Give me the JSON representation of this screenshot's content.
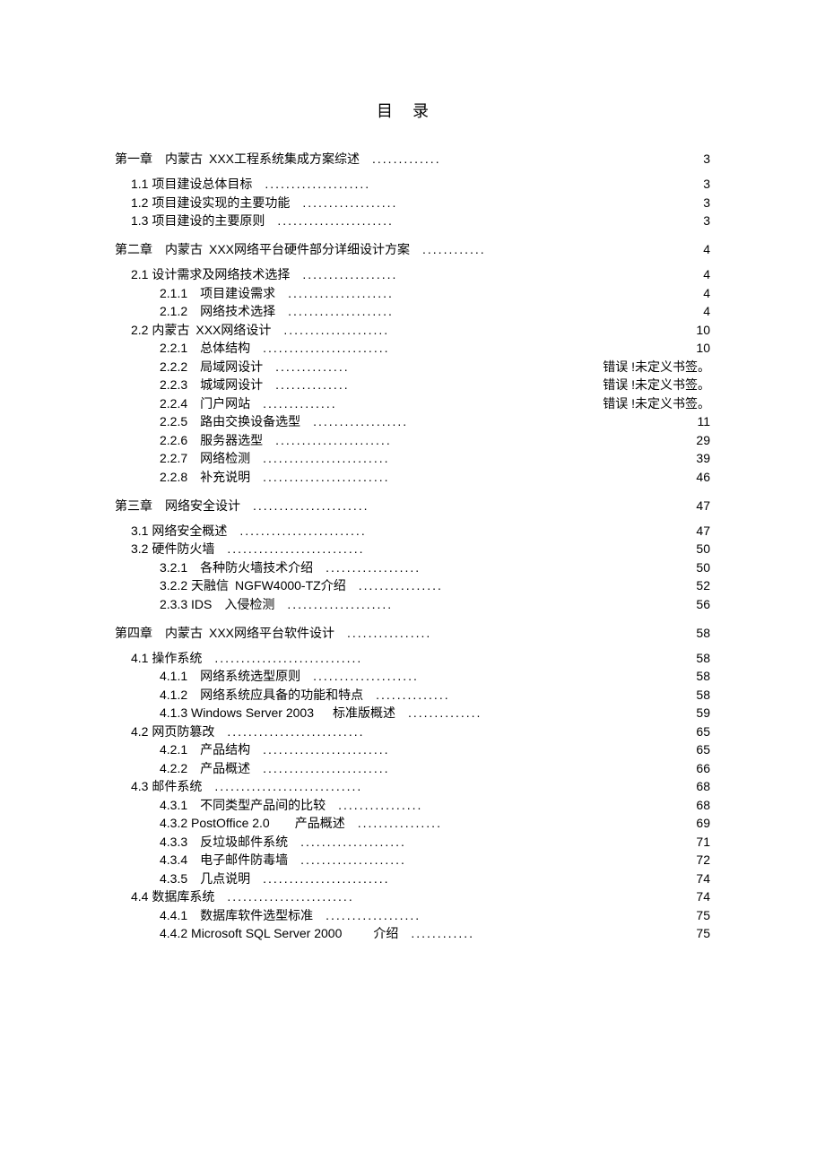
{
  "title": "目录",
  "errorText": "错误 !未定义书签。",
  "entries": [
    {
      "level": 0,
      "label": "第一章 内蒙古 XXX工程系统集成方案综述",
      "page": "3",
      "dots": 13
    },
    {
      "level": 1,
      "label": "1.1  项目建设总体目标",
      "page": "3",
      "dots": 20
    },
    {
      "level": 1,
      "label": "1.2  项目建设实现的主要功能",
      "page": "3",
      "dots": 18
    },
    {
      "level": 1,
      "label": "1.3  项目建设的主要原则",
      "page": "3",
      "dots": 22
    },
    {
      "level": 0,
      "label": "第二章 内蒙古 XXX网络平台硬件部分详细设计方案",
      "page": "4",
      "dots": 12
    },
    {
      "level": 1,
      "label": "2.1  设计需求及网络技术选择",
      "page": "4",
      "dots": 18
    },
    {
      "level": 2,
      "label": "2.1.1 项目建设需求",
      "page": "4",
      "dots": 20
    },
    {
      "level": 2,
      "label": "2.1.2 网络技术选择",
      "page": "4",
      "dots": 20
    },
    {
      "level": 1,
      "label": "2.2  内蒙古 XXX网络设计",
      "page": "10",
      "dots": 20
    },
    {
      "level": 2,
      "label": "2.2.1 总体结构",
      "page": "10",
      "dots": 24
    },
    {
      "level": 2,
      "label": "2.2.2 局域网设计",
      "page": "error",
      "dots": 14
    },
    {
      "level": 2,
      "label": "2.2.3 城域网设计",
      "page": "error",
      "dots": 14
    },
    {
      "level": 2,
      "label": "2.2.4 门户网站",
      "page": "error",
      "dots": 14
    },
    {
      "level": 2,
      "label": "2.2.5 路由交换设备选型",
      "page": "11",
      "dots": 18
    },
    {
      "level": 2,
      "label": "2.2.6 服务器选型",
      "page": "29",
      "dots": 22
    },
    {
      "level": 2,
      "label": "2.2.7 网络检测",
      "page": "39",
      "dots": 24
    },
    {
      "level": 2,
      "label": "2.2.8 补充说明",
      "page": "46",
      "dots": 24
    },
    {
      "level": 0,
      "label": "第三章 网络安全设计",
      "page": "47",
      "dots": 22
    },
    {
      "level": 1,
      "label": "3.1  网络安全概述",
      "page": "47",
      "dots": 24
    },
    {
      "level": 1,
      "label": "3.2  硬件防火墙",
      "page": "50",
      "dots": 26
    },
    {
      "level": 2,
      "label": "3.2.1 各种防火墙技术介绍",
      "page": "50",
      "dots": 18
    },
    {
      "level": 2,
      "label": "3.2.2  天融信 NGFW4000-TZ介绍",
      "page": "52",
      "dots": 16
    },
    {
      "level": 2,
      "label": "2.3.3 IDS 入侵检测",
      "page": "56",
      "dots": 20
    },
    {
      "level": 0,
      "label": "第四章 内蒙古 XXX网络平台软件设计",
      "page": "58",
      "dots": 16
    },
    {
      "level": 1,
      "label": "4.1  操作系统",
      "page": "58",
      "dots": 28
    },
    {
      "level": 2,
      "label": "4.1.1 网络系统选型原则",
      "page": "58",
      "dots": 20
    },
    {
      "level": 2,
      "label": "4.1.2 网络系统应具备的功能和特点",
      "page": "58",
      "dots": 14
    },
    {
      "level": 2,
      "label": "4.1.3 Windows Server 2003  标准版概述",
      "page": "59",
      "dots": 14
    },
    {
      "level": 1,
      "label": "4.2  网页防篡改",
      "page": "65",
      "dots": 26
    },
    {
      "level": 2,
      "label": "4.2.1 产品结构",
      "page": "65",
      "dots": 24
    },
    {
      "level": 2,
      "label": "4.2.2 产品概述",
      "page": "66",
      "dots": 24
    },
    {
      "level": 1,
      "label": "4.3  邮件系统",
      "page": "68",
      "dots": 28
    },
    {
      "level": 2,
      "label": "4.3.1 不同类型产品间的比较",
      "page": "68",
      "dots": 16
    },
    {
      "level": 2,
      "label": "4.3.2 PostOffice 2.0  产品概述",
      "page": "69",
      "dots": 16
    },
    {
      "level": 2,
      "label": "4.3.3 反垃圾邮件系统",
      "page": "71",
      "dots": 20
    },
    {
      "level": 2,
      "label": "4.3.4 电子邮件防毒墙",
      "page": "72",
      "dots": 20
    },
    {
      "level": 2,
      "label": "4.3.5 几点说明",
      "page": "74",
      "dots": 24
    },
    {
      "level": 1,
      "label": "4.4  数据库系统",
      "page": "74",
      "dots": 24
    },
    {
      "level": 2,
      "label": "4.4.1 数据库软件选型标准",
      "page": "75",
      "dots": 18
    },
    {
      "level": 2,
      "label": "4.4.2 Microsoft SQL Server 2000   介绍",
      "page": "75",
      "dots": 12
    }
  ]
}
